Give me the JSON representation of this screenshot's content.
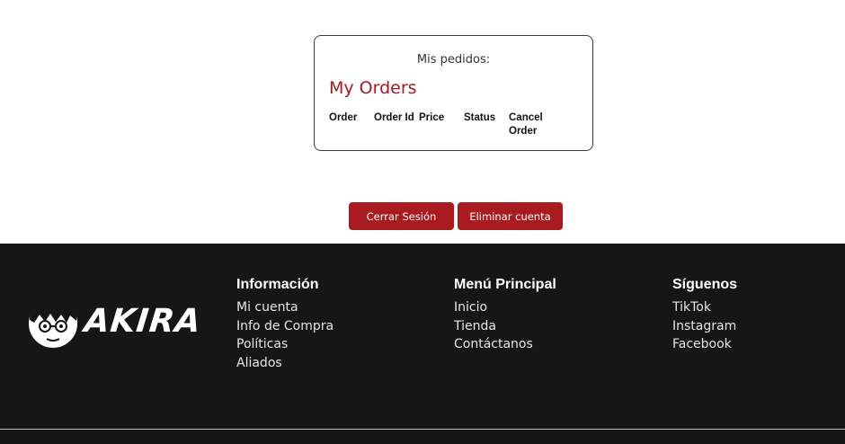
{
  "orders": {
    "subtitle": "Mis pedidos:",
    "title": "My Orders",
    "columns": [
      "Order",
      "Order Id",
      "Price",
      "Status",
      "Cancel Order"
    ]
  },
  "actions": {
    "logout_label": "Cerrar Sesión",
    "delete_label": "Eliminar cuenta"
  },
  "footer": {
    "logo_text": "AKIRA",
    "info": {
      "heading": "Información",
      "links": [
        "Mi cuenta",
        "Info de Compra",
        "Políticas",
        "Aliados"
      ]
    },
    "menu": {
      "heading": "Menú Principal",
      "links": [
        "Inicio",
        "Tienda",
        "Contáctanos"
      ]
    },
    "social": {
      "heading": "Síguenos",
      "links": [
        "TikTok",
        "Instagram",
        "Facebook"
      ]
    }
  },
  "colors": {
    "accent": "#a91b1f",
    "footer_bg": "#161616"
  }
}
